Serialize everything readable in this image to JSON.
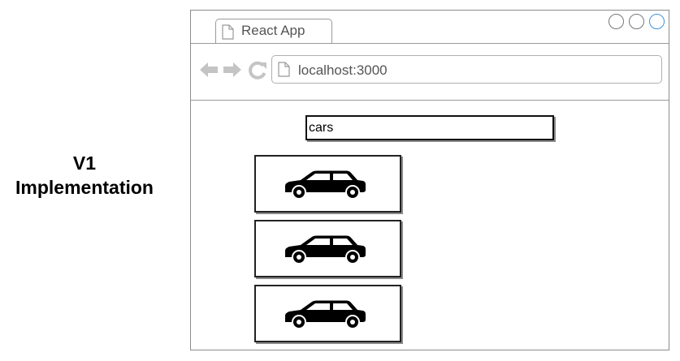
{
  "side_label": {
    "line1": "V1",
    "line2": "Implementation"
  },
  "browser": {
    "tab_title": "React App",
    "url": "localhost:3000",
    "window_buttons": [
      "minimize",
      "maximize",
      "close"
    ],
    "accent_color": "#3a92e0"
  },
  "search": {
    "value": "cars"
  },
  "results": [
    {
      "icon": "car-icon"
    },
    {
      "icon": "car-icon"
    },
    {
      "icon": "car-icon"
    }
  ]
}
